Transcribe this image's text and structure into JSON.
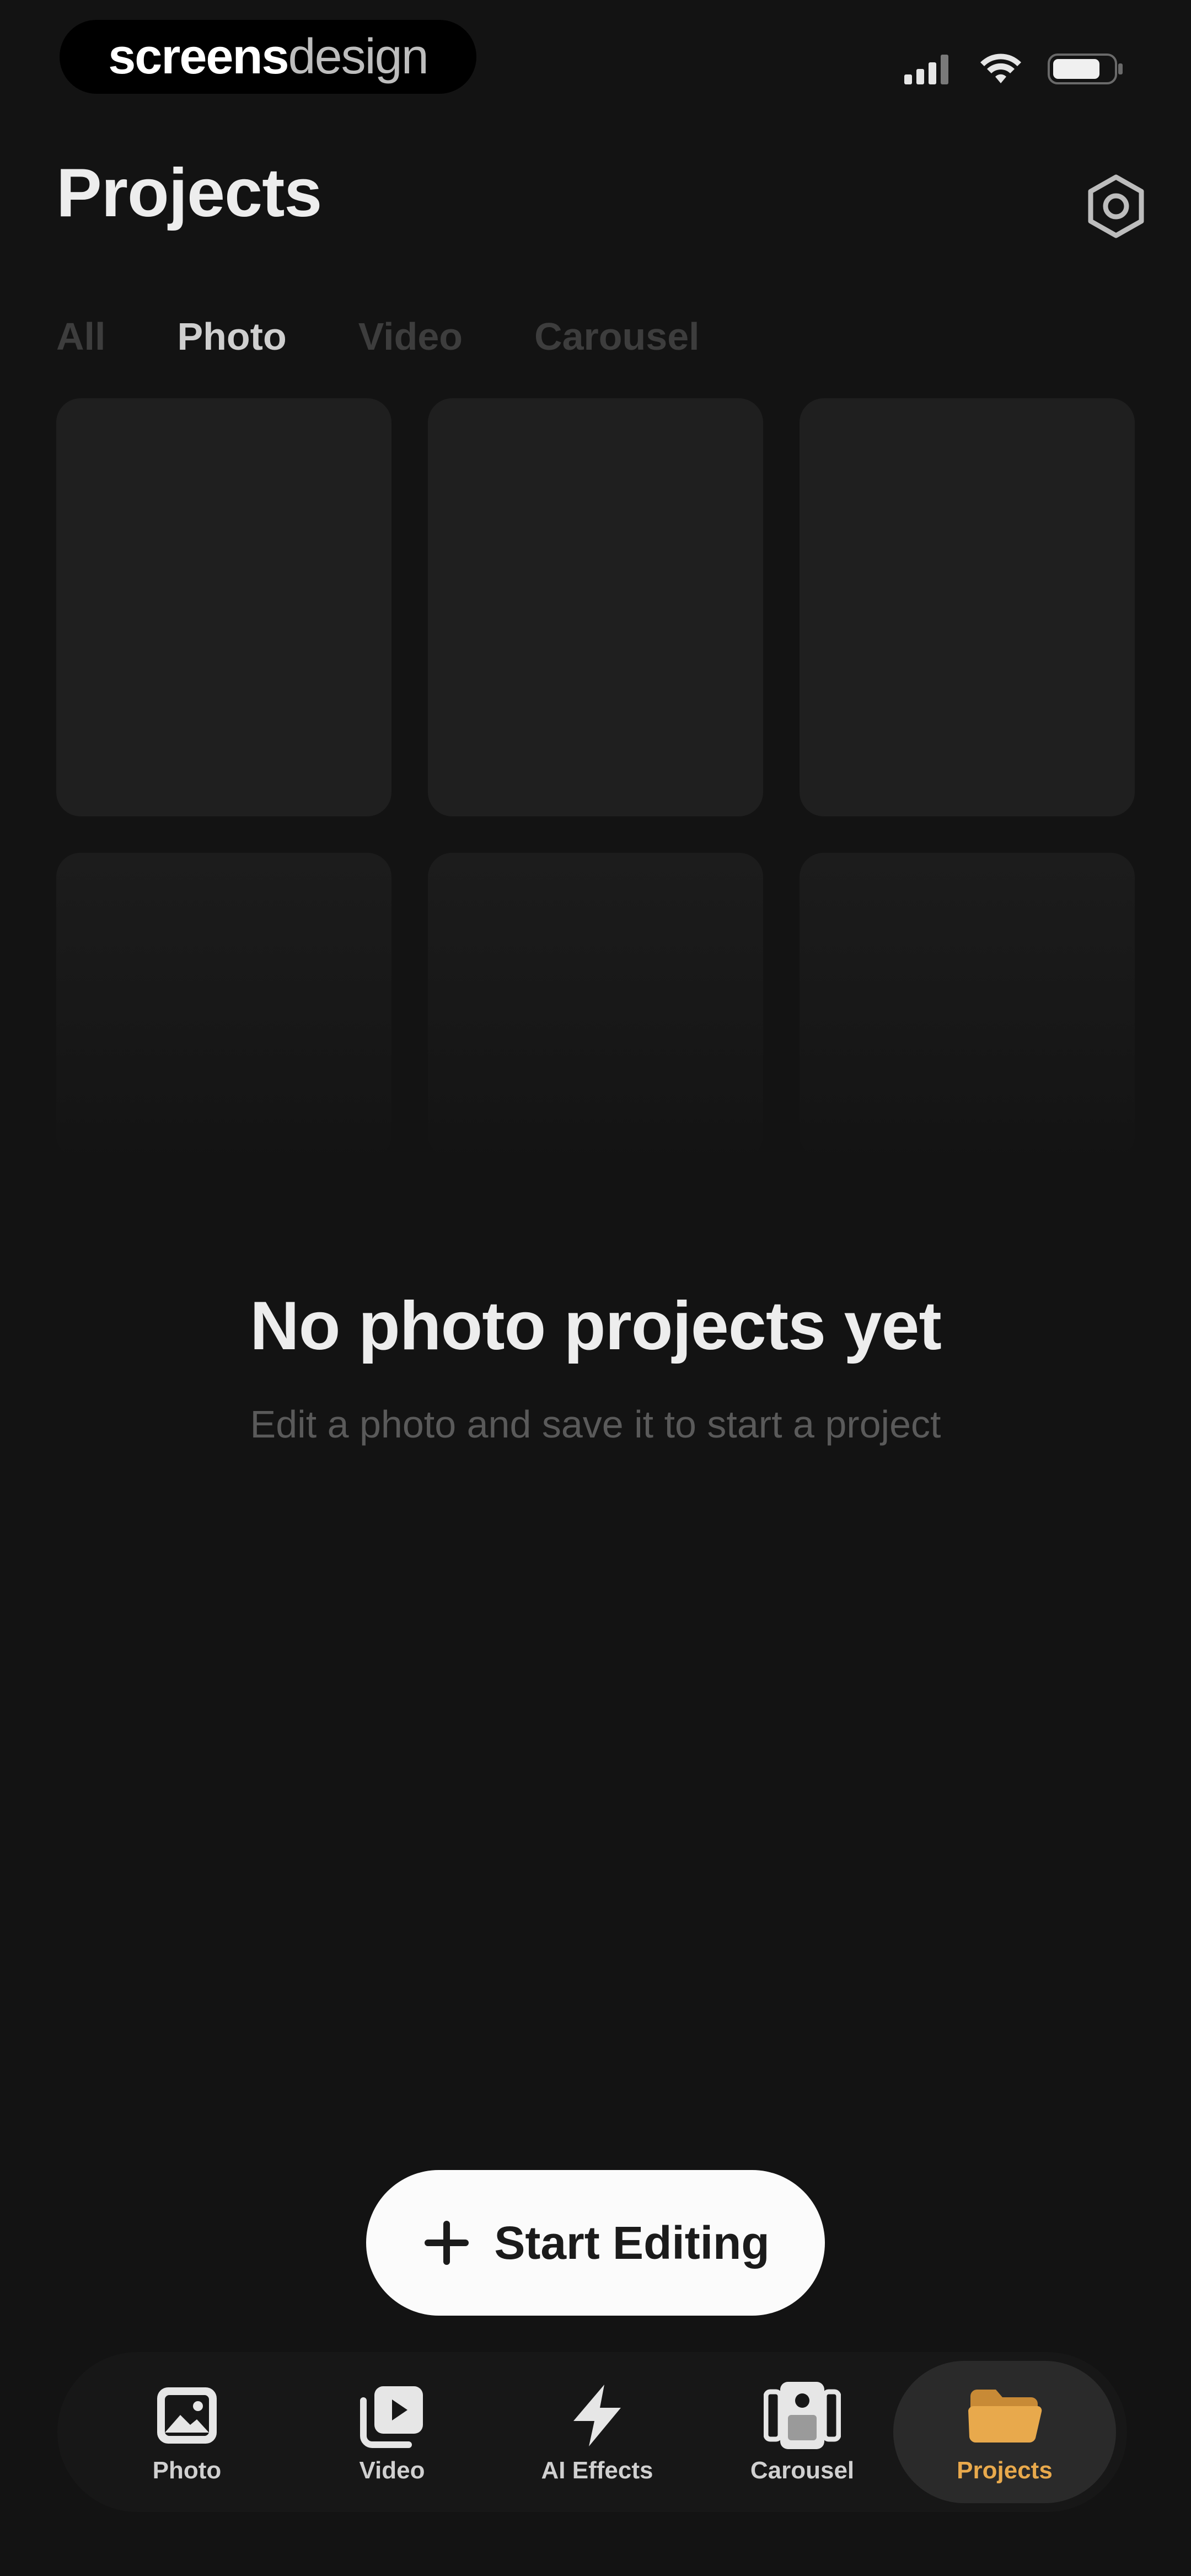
{
  "status_bar": {
    "brand_part1": "screens",
    "brand_part2": "design"
  },
  "header": {
    "title": "Projects"
  },
  "tabs": [
    {
      "label": "All",
      "active": false
    },
    {
      "label": "Photo",
      "active": true
    },
    {
      "label": "Video",
      "active": false
    },
    {
      "label": "Carousel",
      "active": false
    }
  ],
  "empty_state": {
    "title": "No photo projects yet",
    "subtitle": "Edit a photo and save it to start a project"
  },
  "start_button": {
    "label": "Start Editing",
    "icon": "plus-icon"
  },
  "bottom_nav": [
    {
      "label": "Photo",
      "icon": "photo-icon",
      "active": false
    },
    {
      "label": "Video",
      "icon": "video-icon",
      "active": false
    },
    {
      "label": "AI Effects",
      "icon": "lightning-icon",
      "active": false
    },
    {
      "label": "Carousel",
      "icon": "carousel-icon",
      "active": false
    },
    {
      "label": "Projects",
      "icon": "folder-icon",
      "active": true
    }
  ],
  "colors": {
    "background": "#131313",
    "accent": "#E8A94C",
    "tile": "#1F1F1F",
    "button": "#FBFBFB"
  }
}
